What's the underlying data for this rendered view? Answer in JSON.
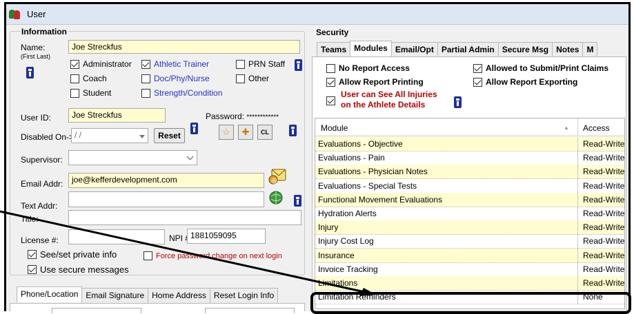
{
  "window": {
    "title": "User"
  },
  "info": {
    "legend": "Information",
    "name_label": "Name:",
    "name_sublabel": "(First Last)",
    "name_value": "Joe Streckfus",
    "roles": [
      {
        "label": "Administrator",
        "checked": true,
        "color": "black"
      },
      {
        "label": "Athletic Trainer",
        "checked": true,
        "color": "blue"
      },
      {
        "label": "PRN Staff",
        "checked": false,
        "color": "black"
      },
      {
        "label": "Coach",
        "checked": false,
        "color": "black"
      },
      {
        "label": "Doc/Phy/Nurse",
        "checked": false,
        "color": "blue"
      },
      {
        "label": "Other",
        "checked": false,
        "color": "black"
      },
      {
        "label": "Student",
        "checked": false,
        "color": "black"
      },
      {
        "label": "Strength/Condition",
        "checked": false,
        "color": "blue"
      }
    ],
    "userid_label": "User ID:",
    "userid_value": "Joe Streckfus",
    "password_label": "Password:",
    "password_value": "************",
    "disabled_label": "Disabled On->",
    "disabled_value": "/   /",
    "reset_label": "Reset",
    "star_glyph": "☆",
    "cross_glyph": "✚",
    "cl_label": "CL",
    "supervisor_label": "Supervisor:",
    "supervisor_value": "",
    "email_label": "Email Addr:",
    "email_value": "joe@kefferdevelopment.com",
    "text_label": "Text Addr:",
    "text_value": "",
    "title_label": "Title:",
    "title_value": "",
    "license_label": "License #:",
    "license_value": "",
    "npi_label": "NPI #:",
    "npi_value": "1881059095",
    "private_label": "See/set private info",
    "private_checked": true,
    "force_label": "Force password change on next login",
    "force_checked": false,
    "secure_label": "Use secure messages",
    "secure_checked": true
  },
  "bottom_tabs": [
    "Phone/Location",
    "Email Signature",
    "Home Address",
    "Reset Login Info"
  ],
  "security": {
    "legend": "Security",
    "tabs": [
      "Teams",
      "Modules",
      "Email/Opt",
      "Partial Admin",
      "Secure Msg",
      "Notes",
      "M"
    ],
    "selected_tab": "Modules",
    "options": {
      "no_report_access": {
        "label": "No Report Access",
        "checked": false
      },
      "allow_report_printing": {
        "label": "Allow Report Printing",
        "checked": true
      },
      "see_injuries_line1": "User can See All Injuries",
      "see_injuries_line2": "on the Athlete Details",
      "see_injuries_checked": true,
      "allowed_submit": {
        "label": "Allowed to Submit/Print Claims",
        "checked": true
      },
      "allow_report_exporting": {
        "label": "Allow Report Exporting",
        "checked": true
      }
    }
  },
  "modules_grid": {
    "columns": [
      "Module",
      "Access"
    ],
    "sort_glyph": "▲",
    "rows": [
      {
        "module": "Evaluations - Objective",
        "access": "Read-Write",
        "highlight": true
      },
      {
        "module": "Evaluations - Pain",
        "access": "Read-Write",
        "highlight": false
      },
      {
        "module": "Evaluations - Physician Notes",
        "access": "Read-Write",
        "highlight": true
      },
      {
        "module": "Evaluations - Special Tests",
        "access": "Read-Write",
        "highlight": false
      },
      {
        "module": "Functional Movement Evaluations",
        "access": "Read-Write",
        "highlight": true
      },
      {
        "module": "Hydration Alerts",
        "access": "Read-Write",
        "highlight": false
      },
      {
        "module": "Injury",
        "access": "Read-Write",
        "highlight": true
      },
      {
        "module": "Injury Cost Log",
        "access": "Read-Write",
        "highlight": false
      },
      {
        "module": "Insurance",
        "access": "Read-Write",
        "highlight": true
      },
      {
        "module": "Invoice Tracking",
        "access": "Read-Write",
        "highlight": false
      },
      {
        "module": "Limitations",
        "access": "Read-Write",
        "highlight": true
      },
      {
        "module": "Limitation Reminders",
        "access": "None",
        "highlight": false
      }
    ]
  },
  "colors": {
    "highlight_yellow": "#fffdd0",
    "link_blue": "#2233cc",
    "warn_red": "#b80000",
    "titlebar": "#dde7f3"
  }
}
